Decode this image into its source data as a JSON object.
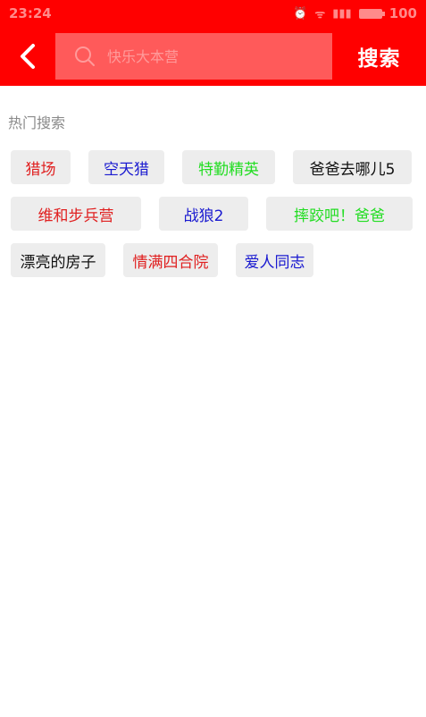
{
  "status_bar": {
    "time": "23:24",
    "signal_text": "Ƨ",
    "network_text": "::::: ",
    "battery_level": "100"
  },
  "header": {
    "search_placeholder": "快乐大本营",
    "search_button_label": "搜索"
  },
  "hot_search": {
    "title": "热门搜索",
    "tags": [
      {
        "label": "猎场",
        "color": "#e02020"
      },
      {
        "label": "空天猎",
        "color": "#1a1ad0"
      },
      {
        "label": "特勤精英",
        "color": "#22dd22"
      },
      {
        "label": "爸爸去哪儿5",
        "color": "#111111"
      },
      {
        "label": "维和步兵营",
        "color": "#e02020"
      },
      {
        "label": "战狼2",
        "color": "#1a1ad0"
      },
      {
        "label": "摔跤吧！爸爸",
        "color": "#22dd22"
      },
      {
        "label": "漂亮的房子",
        "color": "#111111"
      },
      {
        "label": "情满四合院",
        "color": "#e02020"
      },
      {
        "label": "爱人同志",
        "color": "#1a1ad0"
      }
    ]
  },
  "colors": {
    "brand_red": "#ff0000",
    "search_box_bg": "#ff5a5a",
    "tag_bg": "#ededed"
  }
}
